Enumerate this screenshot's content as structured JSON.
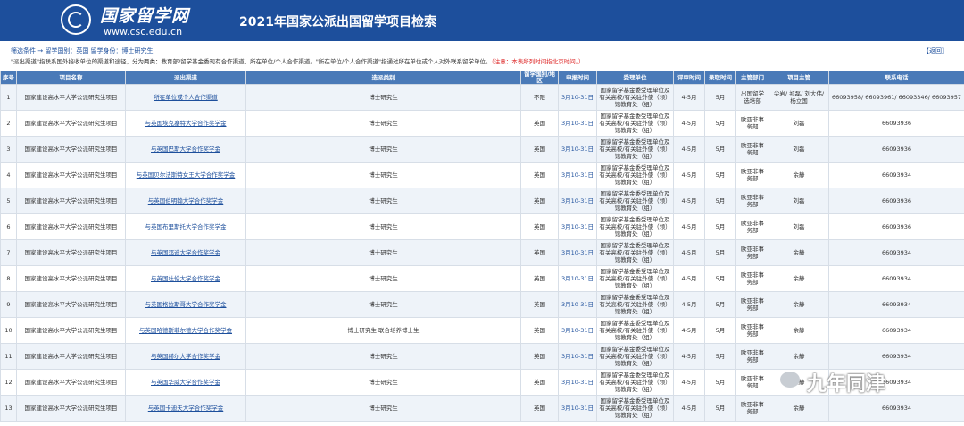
{
  "header": {
    "logo_name": "国家留学网",
    "logo_url": "www.csc.edu.cn",
    "title": "2021年国家公派出国留学项目检索"
  },
  "filter": {
    "text": "筛选条件 → 留学国别：英国 留学身份：博士研究生",
    "back_label": "【返回】"
  },
  "notice": {
    "text": "\"派出渠道\"指联系国外接收单位的渠道和途径，分为两类：教育部/留学基金委现有合作渠道、所在单位/个人合作渠道。\"所在单位/个人合作渠道\"指通过所在单位或个人对外联系留学单位。",
    "red": "（注意：本表所列时间指北京时间。）"
  },
  "columns": [
    "序号",
    "项目名称",
    "派出渠道",
    "选派类别",
    "留学国别/地区",
    "申报时间",
    "受理单位",
    "评审时间",
    "录取时间",
    "主管部门",
    "项目主管",
    "联系电话"
  ],
  "rows": [
    {
      "no": "1",
      "project": "国家建设高水平大学公派研究生项目",
      "channel": "所在单位或个人合作渠道",
      "category": "博士研究生",
      "country": "不限",
      "date": "3月10-31日",
      "unit": "国家留学基金委受理单位及有关高校/有关驻外使（领）馆教育处（组）",
      "review": "4-5月",
      "admit": "5月",
      "dept": "出国留学选培部",
      "manager": "尖岩/ 祁磊/ 刘大伟/ 杨立国",
      "phone": "66093958/ 66093961/ 66093346/ 66093957"
    },
    {
      "no": "2",
      "project": "国家建设高水平大学公派研究生项目",
      "channel": "与英国埃克塞特大学合作奖学金",
      "category": "博士研究生",
      "country": "英国",
      "date": "3月10-31日",
      "unit": "国家留学基金委受理单位及有关高校/有关驻外使（领）馆教育处（组）",
      "review": "4-5月",
      "admit": "5月",
      "dept": "欧亚非事务部",
      "manager": "刘磊",
      "phone": "66093936"
    },
    {
      "no": "3",
      "project": "国家建设高水平大学公派研究生项目",
      "channel": "与英国巴斯大学合作奖学金",
      "category": "博士研究生",
      "country": "英国",
      "date": "3月10-31日",
      "unit": "国家留学基金委受理单位及有关高校/有关驻外使（领）馆教育处（组）",
      "review": "4-5月",
      "admit": "5月",
      "dept": "欧亚非事务部",
      "manager": "刘磊",
      "phone": "66093936"
    },
    {
      "no": "4",
      "project": "国家建设高水平大学公派研究生项目",
      "channel": "与英国贝尔法斯特女王大学合作奖学金",
      "category": "博士研究生",
      "country": "英国",
      "date": "3月10-31日",
      "unit": "国家留学基金委受理单位及有关高校/有关驻外使（领）馆教育处（组）",
      "review": "4-5月",
      "admit": "5月",
      "dept": "欧亚非事务部",
      "manager": "余静",
      "phone": "66093934"
    },
    {
      "no": "5",
      "project": "国家建设高水平大学公派研究生项目",
      "channel": "与英国伯明翰大学合作奖学金",
      "category": "博士研究生",
      "country": "英国",
      "date": "3月10-31日",
      "unit": "国家留学基金委受理单位及有关高校/有关驻外使（领）馆教育处（组）",
      "review": "4-5月",
      "admit": "5月",
      "dept": "欧亚非事务部",
      "manager": "刘磊",
      "phone": "66093936"
    },
    {
      "no": "6",
      "project": "国家建设高水平大学公派研究生项目",
      "channel": "与英国布里斯托大学合作奖学金",
      "category": "博士研究生",
      "country": "英国",
      "date": "3月10-31日",
      "unit": "国家留学基金委受理单位及有关高校/有关驻外使（领）馆教育处（组）",
      "review": "4-5月",
      "admit": "5月",
      "dept": "欧亚非事务部",
      "manager": "刘磊",
      "phone": "66093936"
    },
    {
      "no": "7",
      "project": "国家建设高水平大学公派研究生项目",
      "channel": "与英国邓迪大学合作奖学金",
      "category": "博士研究生",
      "country": "英国",
      "date": "3月10-31日",
      "unit": "国家留学基金委受理单位及有关高校/有关驻外使（领）馆教育处（组）",
      "review": "4-5月",
      "admit": "5月",
      "dept": "欧亚非事务部",
      "manager": "余静",
      "phone": "66093934"
    },
    {
      "no": "8",
      "project": "国家建设高水平大学公派研究生项目",
      "channel": "与英国杜伦大学合作奖学金",
      "category": "博士研究生",
      "country": "英国",
      "date": "3月10-31日",
      "unit": "国家留学基金委受理单位及有关高校/有关驻外使（领）馆教育处（组）",
      "review": "4-5月",
      "admit": "5月",
      "dept": "欧亚非事务部",
      "manager": "余静",
      "phone": "66093934"
    },
    {
      "no": "9",
      "project": "国家建设高水平大学公派研究生项目",
      "channel": "与英国格拉斯哥大学合作奖学金",
      "category": "博士研究生",
      "country": "英国",
      "date": "3月10-31日",
      "unit": "国家留学基金委受理单位及有关高校/有关驻外使（领）馆教育处（组）",
      "review": "4-5月",
      "admit": "5月",
      "dept": "欧亚非事务部",
      "manager": "余静",
      "phone": "66093934"
    },
    {
      "no": "10",
      "project": "国家建设高水平大学公派研究生项目",
      "channel": "与英国哈德斯菲尔德大学合作奖学金",
      "category": "博士研究生 联合培养博士生",
      "country": "英国",
      "date": "3月10-31日",
      "unit": "国家留学基金委受理单位及有关高校/有关驻外使（领）馆教育处（组）",
      "review": "4-5月",
      "admit": "5月",
      "dept": "欧亚非事务部",
      "manager": "余静",
      "phone": "66093934"
    },
    {
      "no": "11",
      "project": "国家建设高水平大学公派研究生项目",
      "channel": "与英国赫尔大学合作奖学金",
      "category": "博士研究生",
      "country": "英国",
      "date": "3月10-31日",
      "unit": "国家留学基金委受理单位及有关高校/有关驻外使（领）馆教育处（组）",
      "review": "4-5月",
      "admit": "5月",
      "dept": "欧亚非事务部",
      "manager": "余静",
      "phone": "66093934"
    },
    {
      "no": "12",
      "project": "国家建设高水平大学公派研究生项目",
      "channel": "与英国华威大学合作奖学金",
      "category": "博士研究生",
      "country": "英国",
      "date": "3月10-31日",
      "unit": "国家留学基金委受理单位及有关高校/有关驻外使（领）馆教育处（组）",
      "review": "4-5月",
      "admit": "5月",
      "dept": "欧亚非事务部",
      "manager": "余静",
      "phone": "66093934"
    },
    {
      "no": "13",
      "project": "国家建设高水平大学公派研究生项目",
      "channel": "与英国卡迪夫大学合作奖学金",
      "category": "博士研究生",
      "country": "英国",
      "date": "3月10-31日",
      "unit": "国家留学基金委受理单位及有关高校/有关驻外使（领）馆教育处（组）",
      "review": "4-5月",
      "admit": "5月",
      "dept": "欧亚非事务部",
      "manager": "余静",
      "phone": "66093934"
    }
  ],
  "watermark": {
    "text": "九年同津",
    "icon": "wechat-icon"
  }
}
